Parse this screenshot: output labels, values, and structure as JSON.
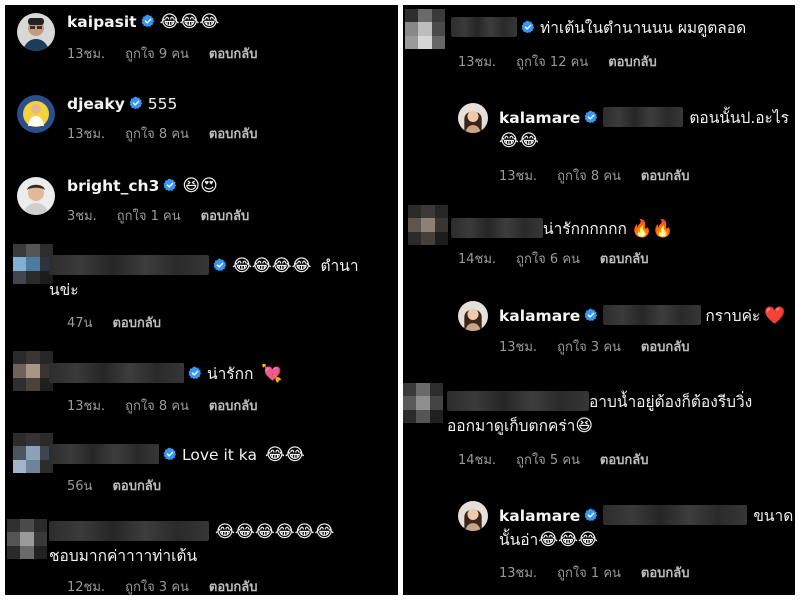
{
  "left": {
    "comments": [
      {
        "username": "kaipasit",
        "text": "",
        "emojis": "😂😂😂",
        "time": "13ชม.",
        "likes": "ถูกใจ 9 คน",
        "reply": "ตอบกลับ"
      },
      {
        "username": "djeaky",
        "text": "555",
        "emojis": "",
        "time": "13ชม.",
        "likes": "ถูกใจ 8 คน",
        "reply": "ตอบกลับ"
      },
      {
        "username": "bright_ch3",
        "text": "",
        "emojis": "😆😍",
        "time": "3ชม.",
        "likes": "ถูกใจ 1 คน",
        "reply": "ตอบกลับ"
      },
      {
        "username": "",
        "text": "ตำนา",
        "text2": "นข่ะ",
        "emojis": "😂😂😂😂",
        "time": "47น",
        "likes": "",
        "reply": "ตอบกลับ"
      },
      {
        "username": "",
        "text": "น่ารักก",
        "emojis": "💘",
        "time": "13ชม.",
        "likes": "ถูกใจ 8 คน",
        "reply": "ตอบกลับ"
      },
      {
        "username": "",
        "text": "Love it ka",
        "emojis": "😂😂",
        "time": "56น",
        "likes": "",
        "reply": "ตอบกลับ"
      },
      {
        "username": "",
        "text": "",
        "text2": "ชอบมากค่าาาาท่าเต้น",
        "emojis": "😂😂😂😂😂😂",
        "time": "12ชม.",
        "likes": "ถูกใจ 3 คน",
        "reply": "ตอบกลับ"
      }
    ]
  },
  "right": {
    "comments": [
      {
        "username": "",
        "text": "ท่าเต้นในตำนานนน ผมดูตลอด",
        "emojis": "",
        "time": "13ชม.",
        "likes": "ถูกใจ 12 คน",
        "reply": "ตอบกลับ"
      },
      {
        "username": "kalamare",
        "text": "ตอนนั้นป.อะไร",
        "emojis2": "😂😂",
        "time": "13ชม.",
        "likes": "ถูกใจ 8 คน",
        "reply": "ตอบกลับ"
      },
      {
        "username": "",
        "text": "น่ารักกกกกก",
        "emojis": "🔥🔥",
        "time": "14ชม.",
        "likes": "ถูกใจ 6 คน",
        "reply": "ตอบกลับ"
      },
      {
        "username": "kalamare",
        "text": "กราบค่ะ",
        "emojis": "❤️",
        "time": "13ชม.",
        "likes": "ถูกใจ 3 คน",
        "reply": "ตอบกลับ"
      },
      {
        "username": "",
        "text": "อาบน้ำอยู่ต้องก็ต้องรีบวิ่ง",
        "text2": "ออกมาดูเก็บตกคร่า",
        "emojis2": "😆",
        "time": "14ชม.",
        "likes": "ถูกใจ 5 คน",
        "reply": "ตอบกลับ"
      },
      {
        "username": "kalamare",
        "text": "ขนาด",
        "text2": "นั้นอ่า",
        "emojis2": "😂😂😂",
        "time": "13ชม.",
        "likes": "ถูกใจ 1 คน",
        "reply": "ตอบกลับ"
      }
    ]
  },
  "colors": {
    "background": "#000000",
    "text": "#f2f2f2",
    "meta": "#9a9a9a",
    "verified": "#3897f0"
  }
}
